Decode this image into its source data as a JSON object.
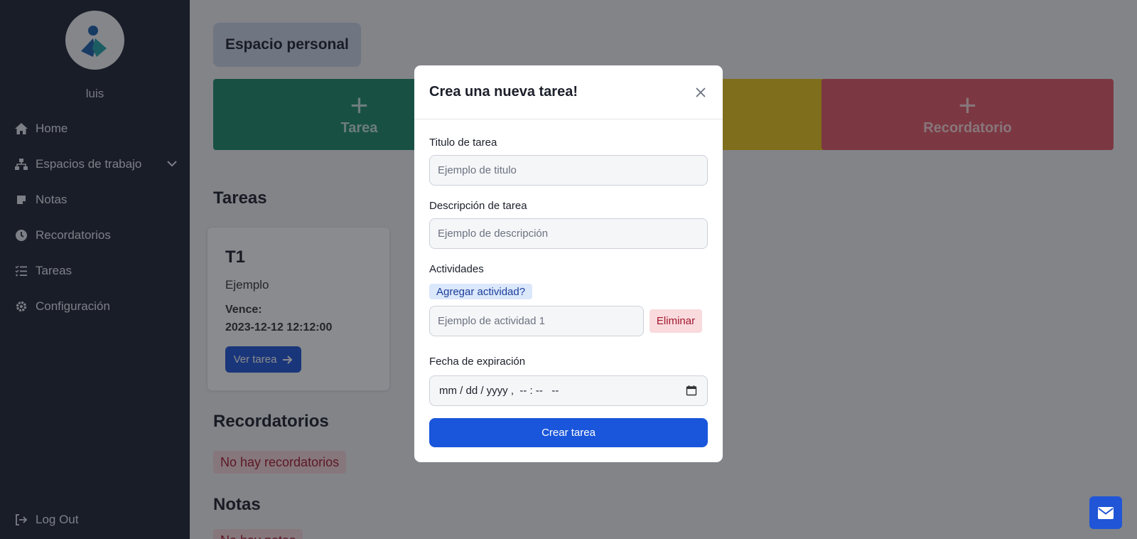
{
  "sidebar": {
    "username": "luis",
    "items": [
      {
        "label": "Home",
        "icon": "home-icon"
      },
      {
        "label": "Espacios de trabajo",
        "icon": "workspaces-icon"
      },
      {
        "label": "Notas",
        "icon": "note-icon"
      },
      {
        "label": "Recordatorios",
        "icon": "clock-icon"
      },
      {
        "label": "Tareas",
        "icon": "task-list-icon"
      },
      {
        "label": "Configuración",
        "icon": "gear-icon"
      }
    ],
    "logout_label": "Log Out"
  },
  "main": {
    "workspace_title": "Espacio personal",
    "quick_cards": [
      {
        "label": "Tarea",
        "color": "#1a8a6b"
      },
      {
        "label": "",
        "color": "#e8c41a"
      },
      {
        "label": "Recordatorio",
        "color": "#e25867"
      }
    ],
    "tasks_heading": "Tareas",
    "task": {
      "title": "T1",
      "description": "Ejemplo",
      "due_label": "Vence:",
      "due_value": "2023-12-12 12:12:00",
      "button_label": "Ver tarea"
    },
    "reminders_heading": "Recordatorios",
    "reminders_empty": "No hay recordatorios",
    "notes_heading": "Notas",
    "notes_empty": "No hay notas"
  },
  "modal": {
    "title": "Crea una nueva tarea!",
    "title_label": "Titulo de tarea",
    "title_placeholder": "Ejemplo de titulo",
    "desc_label": "Descripción de tarea",
    "desc_placeholder": "Ejemplo de descripción",
    "activities_label": "Actividades",
    "add_activity_label": "Agregar actividad?",
    "activity_placeholder": "Ejemplo de actividad 1",
    "delete_label": "Eliminar",
    "expiry_label": "Fecha de expiración",
    "expiry_placeholder": "mm / dd / yyyy ,  -- : --   --",
    "submit_label": "Crear tarea"
  },
  "colors": {
    "sidebar_bg": "#1c2233",
    "primary": "#1a56db",
    "danger_bg": "#f9dadd",
    "danger_text": "#a3182e"
  }
}
